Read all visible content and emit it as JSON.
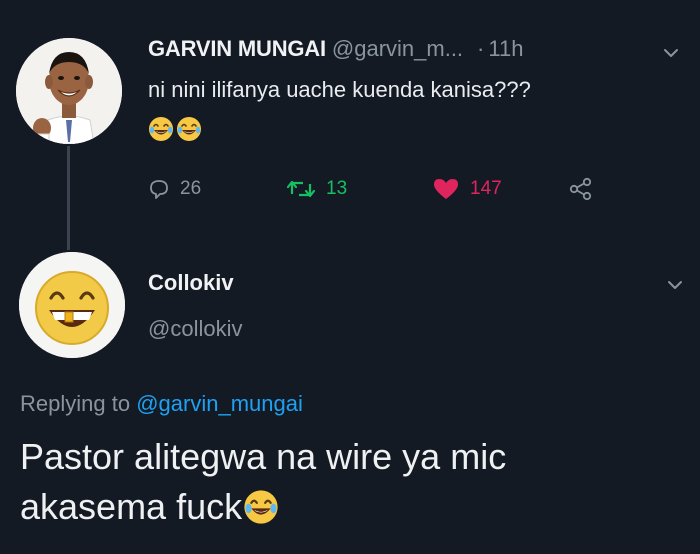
{
  "tweet": {
    "author_name": "GARVIN MUNGAI",
    "author_handle": "@garvin_m...",
    "separator": "·",
    "time": "11h",
    "text": "ni nini ilifanya uache kuenda kanisa???",
    "emojis": [
      "laughing-tears-emoji",
      "laughing-tears-emoji"
    ],
    "stats": {
      "replies": "26",
      "retweets": "13",
      "likes": "147"
    }
  },
  "reply": {
    "author_name": "Collokiv",
    "author_handle": "@collokiv",
    "replying_prefix": "Replying to",
    "replying_to": "@garvin_mungai",
    "text_line1": "Pastor alitegwa na wire ya mic",
    "text_line2": "akasema fuck",
    "trailing_emoji": "laughing-tears-emoji"
  },
  "colors": {
    "background": "#141a24",
    "retweet": "#17bf63",
    "like": "#e0245e",
    "link": "#1da1f2",
    "muted": "#8a949f"
  }
}
